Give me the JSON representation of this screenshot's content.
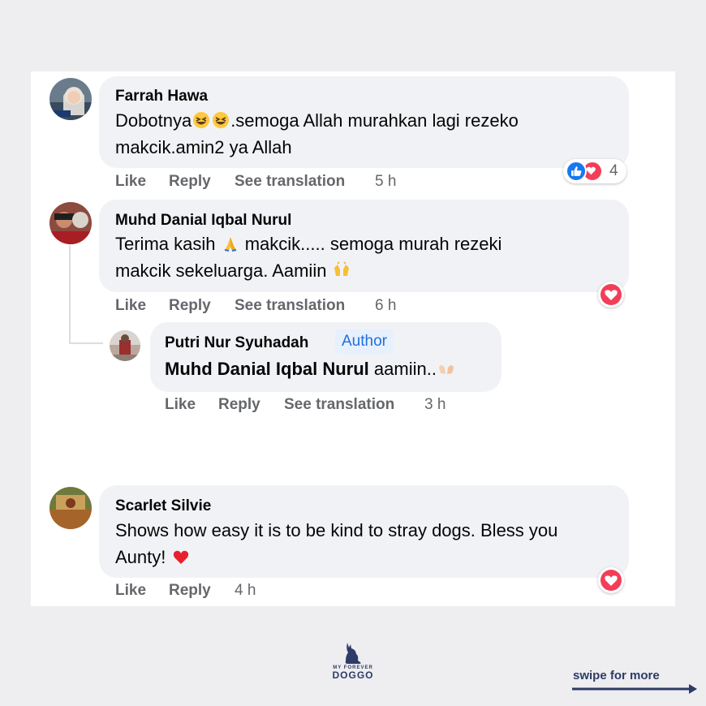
{
  "comments": [
    {
      "name": "Farrah Hawa",
      "text_line1_a": "Dobotnya",
      "text_line1_b": ".semoga Allah murahkan lagi rezeko",
      "text_line2": "makcik.amin2 ya Allah",
      "emoji": [
        "grinning-squint-emoji",
        "grinning-squint-emoji"
      ],
      "actions": {
        "like": "Like",
        "reply": "Reply",
        "translate": "See translation",
        "time": "5 h"
      },
      "reaction_count": "4",
      "reactions": [
        "like",
        "love"
      ]
    },
    {
      "name": "Muhd Danial Iqbal Nurul",
      "text_line1_a": "Terima kasih",
      "text_line1_b": "makcik..... semoga murah rezeki",
      "text_line2": "makcik sekeluarga. Aamiin",
      "emoji": [
        "folded-hands-emoji",
        "raising-hands-emoji"
      ],
      "actions": {
        "like": "Like",
        "reply": "Reply",
        "translate": "See translation",
        "time": "6 h"
      },
      "reactions": [
        "love"
      ]
    },
    {
      "name": "Putri Nur Syuhadah",
      "badge": "Author",
      "mention": "Muhd Danial Iqbal Nurul",
      "text": "aamiin..",
      "emoji": [
        "open-hands-emoji"
      ],
      "actions": {
        "like": "Like",
        "reply": "Reply",
        "translate": "See translation",
        "time": "3 h"
      }
    },
    {
      "name": "Scarlet Silvie",
      "text_line1": "Shows how easy it is to be kind to stray dogs. Bless you",
      "text_line2": "Aunty!",
      "emoji": [
        "red-heart-emoji"
      ],
      "actions": {
        "like": "Like",
        "reply": "Reply",
        "time": "4 h"
      },
      "reactions": [
        "love"
      ]
    }
  ],
  "footer": {
    "logo_small": "MY FOREVER",
    "logo_big": "DOGGO",
    "swipe": "swipe for more"
  },
  "colors": {
    "background": "#eeeef0",
    "bubble": "#f0f2f5",
    "action_gray": "#65676b",
    "like_blue": "#1877f2",
    "love_red": "#f33e58",
    "brand_navy": "#2d3b66",
    "author_badge_bg": "#e7f0fd",
    "author_badge_text": "#216fdb"
  }
}
